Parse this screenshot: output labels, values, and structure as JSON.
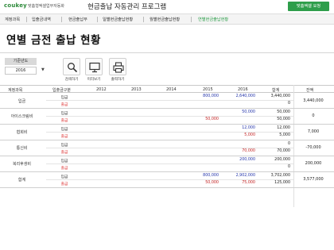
{
  "header": {
    "logo": "coukey",
    "logo_sub": "맞춤형엑셀업무자동화",
    "app_title": "현금출납 자동관리 프로그램",
    "custom_button": "맞춤엑셀 요청"
  },
  "menu": [
    {
      "label": "계정과목",
      "active": false
    },
    {
      "label": "입출금내역",
      "active": false
    },
    {
      "label": "현금출납부",
      "active": false
    },
    {
      "label": "일별현금출납현황",
      "active": false
    },
    {
      "label": "월별현금출납현황",
      "active": false
    },
    {
      "label": "연별현금출납현황",
      "active": true
    }
  ],
  "page_title": "연별 금전 출납 현황",
  "filter": {
    "year_label": "기준년도",
    "year_value": "2016"
  },
  "toolbar": {
    "search_label": "검색하기",
    "preview_label": "미리보기",
    "print_label": "출력하기"
  },
  "table": {
    "headers": [
      "계정과목",
      "입출금구분",
      "2012",
      "2013",
      "2014",
      "2015",
      "2016",
      "합계",
      "잔액"
    ],
    "groups": [
      {
        "category": "입금",
        "balance": "3,440,000",
        "rows": [
          {
            "type": "입금",
            "v2015": "800,000",
            "v2016": "2,640,000",
            "total": "3,440,000"
          },
          {
            "type": "출금",
            "v2015": "",
            "v2016": "",
            "total": "0"
          }
        ]
      },
      {
        "category": "아이스크림비",
        "balance": "0",
        "rows": [
          {
            "type": "입금",
            "v2015": "",
            "v2016": "50,000",
            "total": "50,000"
          },
          {
            "type": "출금",
            "v2015": "50,000",
            "v2016": "",
            "total": "50,000"
          }
        ]
      },
      {
        "category": "협회비",
        "balance": "7,000",
        "rows": [
          {
            "type": "입금",
            "v2015": "",
            "v2016": "12,000",
            "total": "12,000"
          },
          {
            "type": "출금",
            "v2015": "",
            "v2016": "5,000",
            "total": "5,000"
          }
        ]
      },
      {
        "category": "통신비",
        "balance": "-70,000",
        "rows": [
          {
            "type": "입금",
            "v2015": "",
            "v2016": "",
            "total": "0"
          },
          {
            "type": "출금",
            "v2015": "",
            "v2016": "70,000",
            "total": "70,000"
          }
        ]
      },
      {
        "category": "복리후생비",
        "balance": "200,000",
        "rows": [
          {
            "type": "입금",
            "v2015": "",
            "v2016": "200,000",
            "total": "200,000"
          },
          {
            "type": "출금",
            "v2015": "",
            "v2016": "",
            "total": "0"
          }
        ]
      },
      {
        "category": "합계",
        "balance": "3,577,000",
        "rows": [
          {
            "type": "입금",
            "v2015": "800,000",
            "v2016": "2,902,000",
            "total": "3,702,000"
          },
          {
            "type": "출금",
            "v2015": "50,000",
            "v2016": "75,000",
            "total": "125,000"
          }
        ]
      }
    ]
  },
  "colors": {
    "accent": "#2e9e4b",
    "income": "#2233aa",
    "expense": "#c42222"
  }
}
